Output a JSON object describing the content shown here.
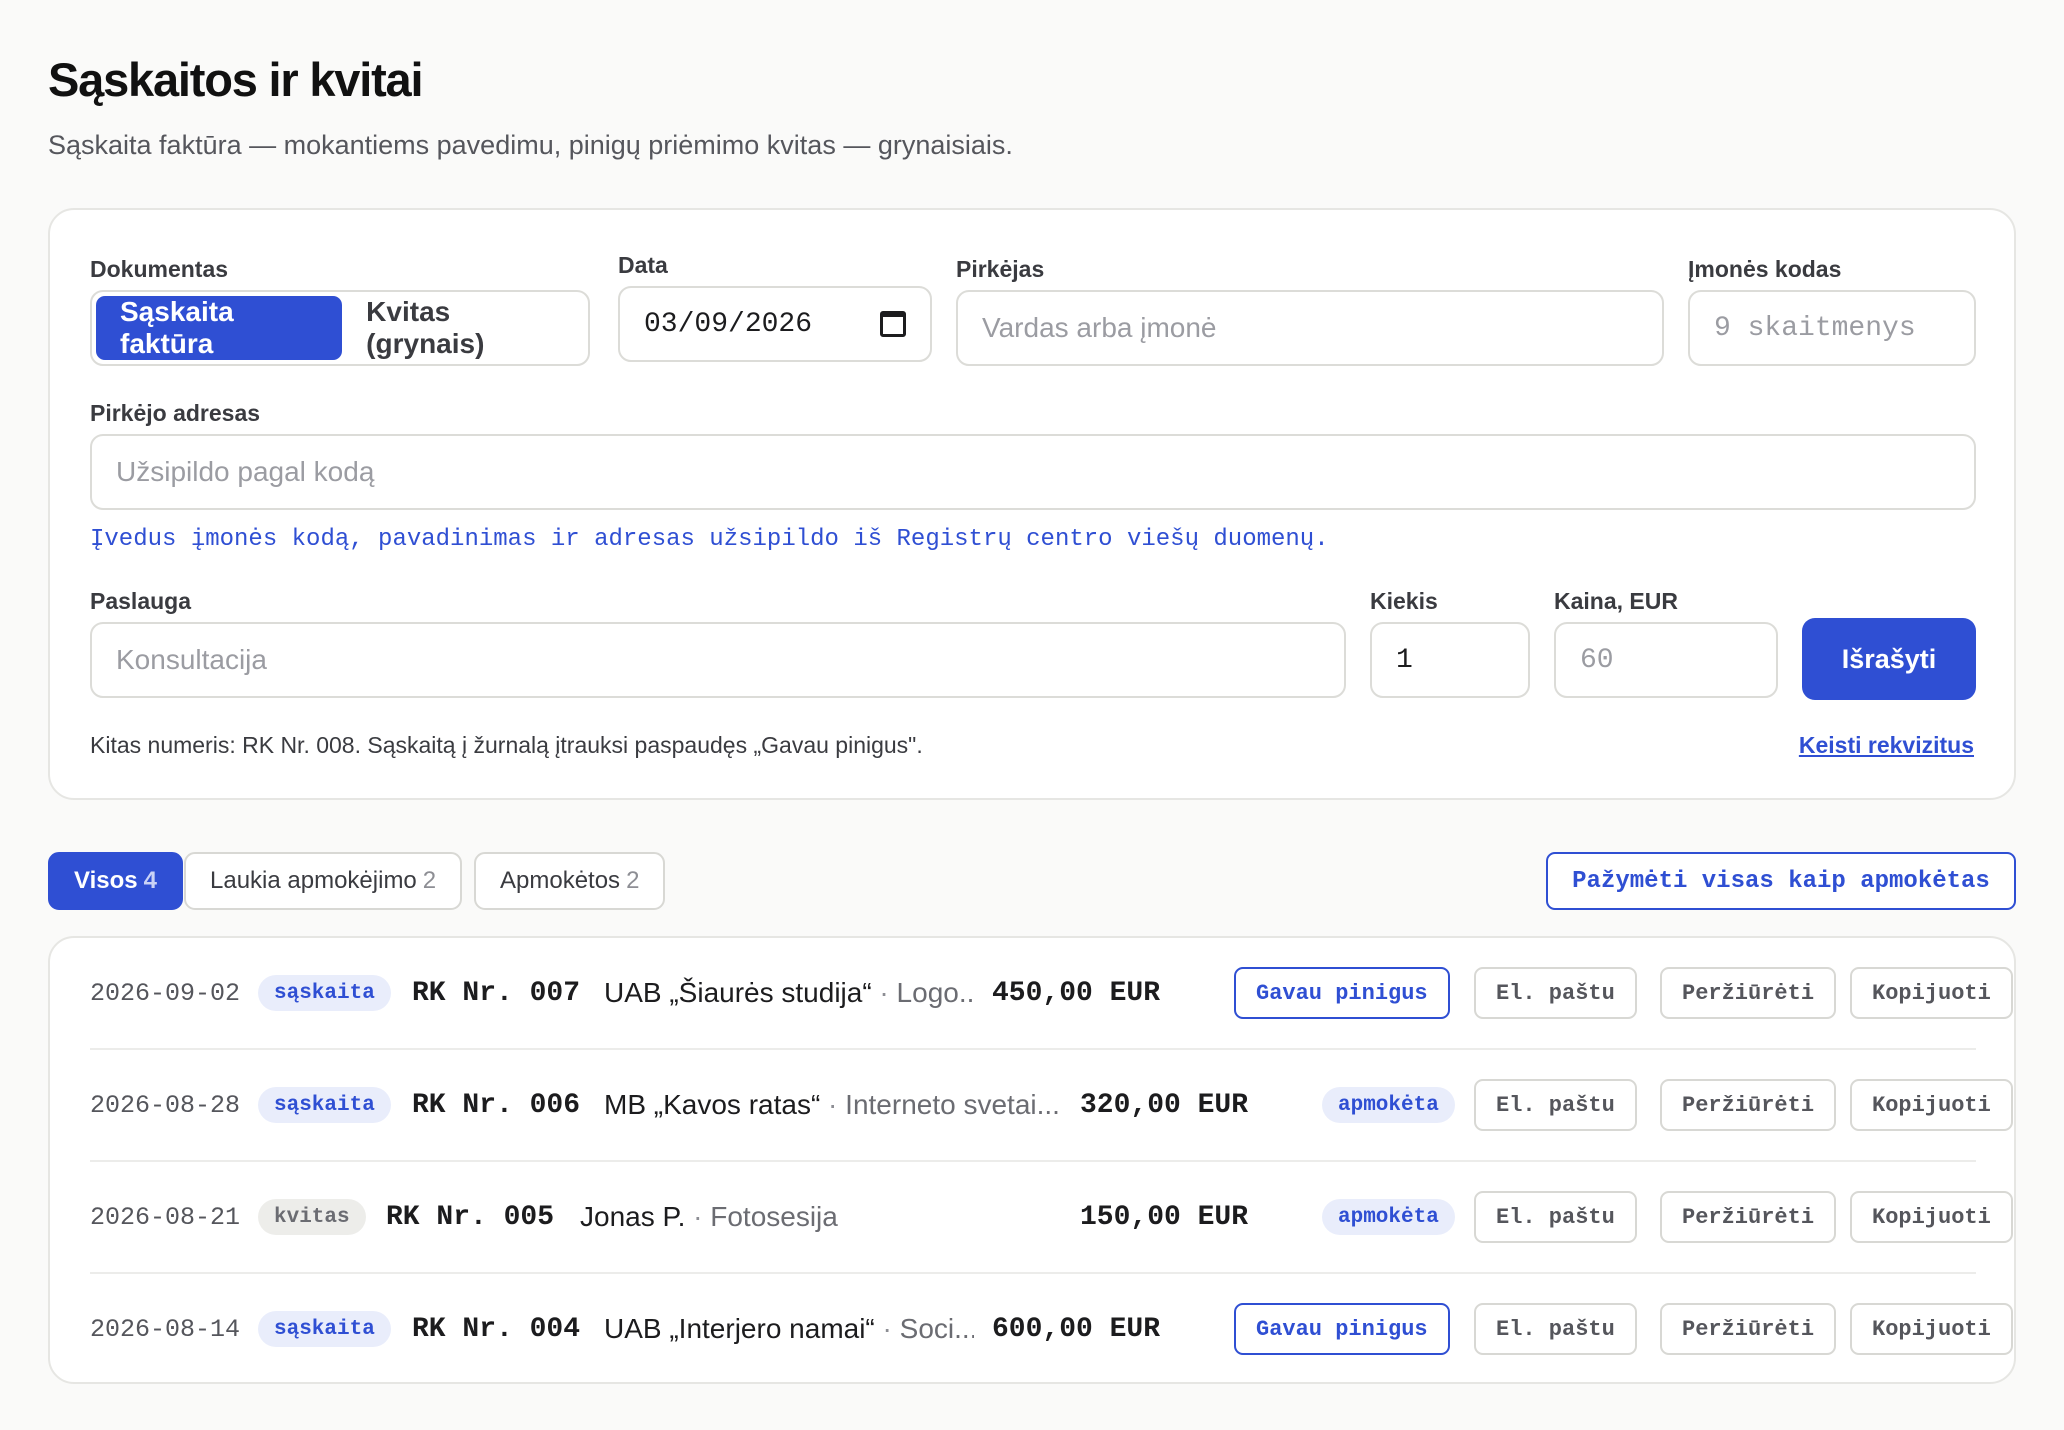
{
  "header": {
    "title": "Sąskaitos ir kvitai",
    "subtitle": "Sąskaita faktūra — mokantiems pavedimu, pinigų priėmimo kvitas — grynaisiais."
  },
  "form": {
    "document_label": "Dokumentas",
    "document_options": [
      "Sąskaita faktūra",
      "Kvitas (grynais)"
    ],
    "document_selected": "Sąskaita faktūra",
    "date_label": "Data",
    "date_value": "03/09/2026",
    "buyer_label": "Pirkėjas",
    "buyer_placeholder": "Vardas arba įmonė",
    "company_code_label": "Įmonės kodas",
    "company_code_placeholder": "9 skaitmenys",
    "address_label": "Pirkėjo adresas",
    "address_placeholder": "Užsipildo pagal kodą",
    "registry_hint": "Įvedus įmonės kodą, pavadinimas ir adresas užsipildo iš Registrų centro viešų duomenų.",
    "service_label": "Paslauga",
    "service_placeholder": "Konsultacija",
    "qty_label": "Kiekis",
    "qty_value": "1",
    "price_label": "Kaina, EUR",
    "price_placeholder": "60",
    "submit_label": "Išrašyti",
    "next_number_note": "Kitas numeris: RK Nr. 008. Sąskaitą į žurnalą įtrauksi paspaudęs „Gavau pinigus\".",
    "change_details_link": "Keisti rekvizitus"
  },
  "filters": [
    {
      "label": "Visos",
      "count": "4",
      "active": true
    },
    {
      "label": "Laukia apmokėjimo",
      "count": "2",
      "active": false
    },
    {
      "label": "Apmokėtos",
      "count": "2",
      "active": false
    }
  ],
  "mark_all_label": "Pažymėti visas kaip apmokėtas",
  "actions": {
    "received": "Gavau pinigus",
    "paid": "apmokėta",
    "email": "El. paštu",
    "view": "Peržiūrėti",
    "copy": "Kopijuoti"
  },
  "invoices": [
    {
      "date": "2026-09-02",
      "type": "sąskaita",
      "number": "RK Nr. 007",
      "party": "UAB „Šiaurės studija“",
      "service": "Logo...",
      "amount": "450,00 EUR",
      "status": "Gavau pinigus"
    },
    {
      "date": "2026-08-28",
      "type": "sąskaita",
      "number": "RK Nr. 006",
      "party": "MB „Kavos ratas“",
      "service": "Interneto svetai...",
      "amount": "320,00 EUR",
      "status": "apmokėta"
    },
    {
      "date": "2026-08-21",
      "type": "kvitas",
      "number": "RK Nr. 005",
      "party": "Jonas P.",
      "service": "Fotosesija",
      "amount": "150,00 EUR",
      "status": "apmokėta"
    },
    {
      "date": "2026-08-14",
      "type": "sąskaita",
      "number": "RK Nr. 004",
      "party": "UAB „Interjero namai“",
      "service": "Soci...",
      "amount": "600,00 EUR",
      "status": "Gavau pinigus"
    }
  ],
  "colors": {
    "accent": "#2f4fd3",
    "background": "#fafaf9",
    "card": "#ffffff"
  }
}
